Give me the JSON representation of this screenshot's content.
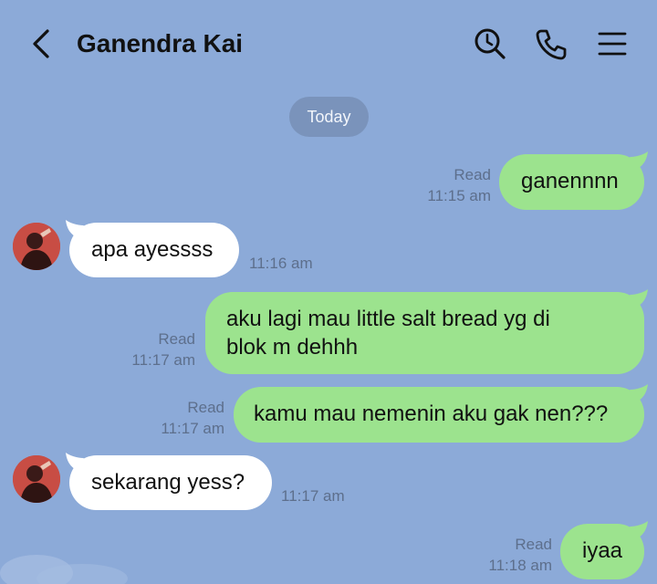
{
  "header": {
    "title": "Ganendra Kai"
  },
  "date_separator": "Today",
  "messages": [
    {
      "text": "ganennnn",
      "status": "Read",
      "time": "11:15 am"
    },
    {
      "text": "apa ayessss",
      "time": "11:16 am"
    },
    {
      "text_line1": "aku lagi mau little salt bread yg di",
      "text_line2": "blok m dehhh",
      "status": "Read",
      "time": "11:17 am"
    },
    {
      "text": "kamu mau nemenin aku gak nen???",
      "status": "Read",
      "time": "11:17 am"
    },
    {
      "text": "sekarang yess?",
      "time": "11:17 am"
    },
    {
      "text": "iyaa",
      "status": "Read",
      "time": "11:18 am"
    }
  ],
  "icons": {
    "back": "back-chevron-icon",
    "search": "search-clock-icon",
    "call": "phone-icon",
    "menu": "menu-icon",
    "avatar": "contact-avatar"
  },
  "colors": {
    "background": "#8caad8",
    "outgoing_bubble": "#9ce38e",
    "incoming_bubble": "#ffffff",
    "date_pill": "#7a93bb"
  }
}
